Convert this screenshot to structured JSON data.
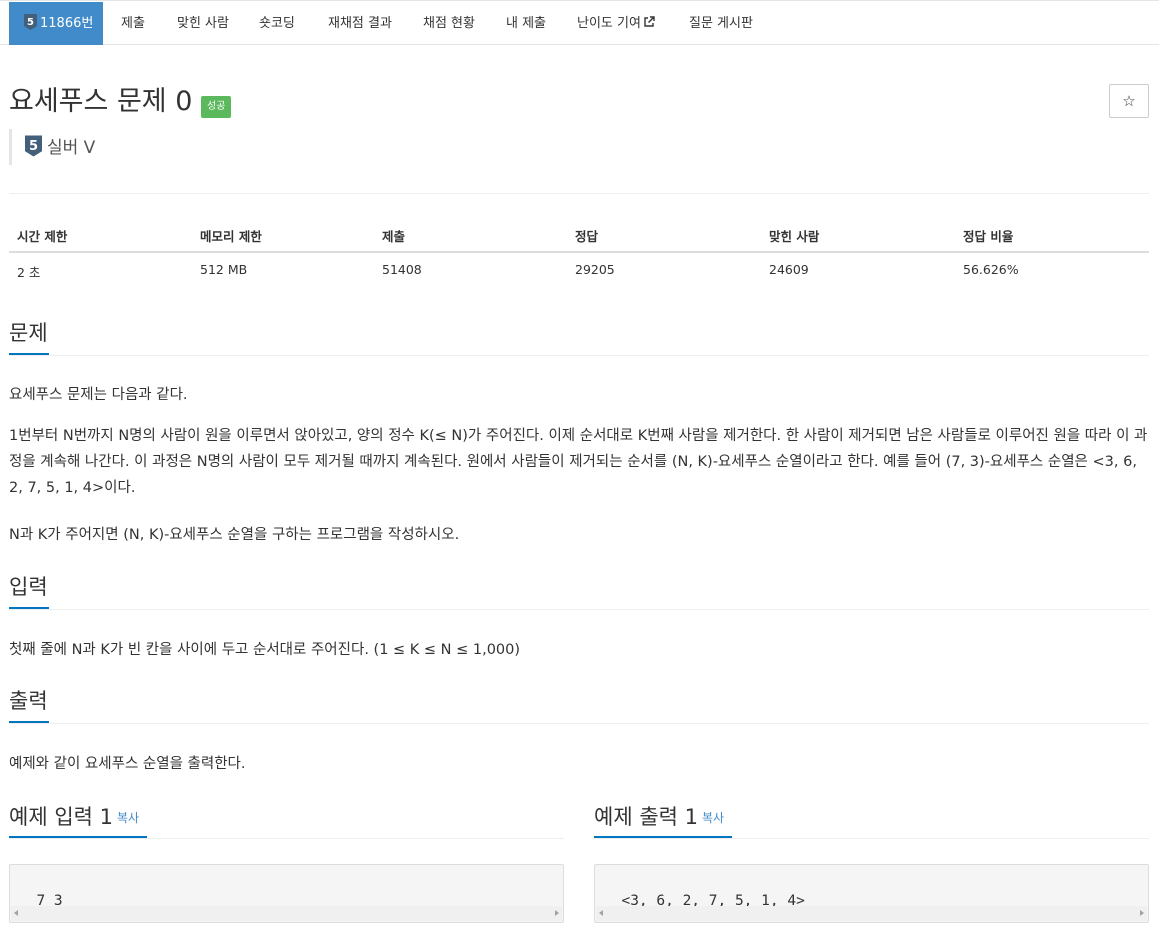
{
  "nav": {
    "problem_id": "11866번",
    "tier_digit": "5",
    "items": [
      {
        "label": "제출"
      },
      {
        "label": "맞힌 사람"
      },
      {
        "label": "숏코딩"
      },
      {
        "label": "재채점 결과"
      },
      {
        "label": "채점 현황"
      },
      {
        "label": "내 제출"
      },
      {
        "label": "난이도 기여"
      },
      {
        "label": "질문 게시판"
      }
    ]
  },
  "problem": {
    "title": "요세푸스 문제 0",
    "status_label": "성공",
    "star": "☆",
    "tier_digit": "5",
    "tier_name": "실버 V"
  },
  "stats": {
    "headers": [
      "시간 제한",
      "메모리 제한",
      "제출",
      "정답",
      "맞힌 사람",
      "정답 비율"
    ],
    "values": [
      "2 초",
      "512 MB",
      "51408",
      "29205",
      "24609",
      "56.626%"
    ]
  },
  "sections": {
    "description_title": "문제",
    "description_p1": "요세푸스 문제는 다음과 같다.",
    "description_p2": "1번부터 N번까지 N명의 사람이 원을 이루면서 앉아있고, 양의 정수 K(≤ N)가 주어진다. 이제 순서대로 K번째 사람을 제거한다. 한 사람이 제거되면 남은 사람들로 이루어진 원을 따라 이 과정을 계속해 나간다. 이 과정은 N명의 사람이 모두 제거될 때까지 계속된다. 원에서 사람들이 제거되는 순서를 (N, K)-요세푸스 순열이라고 한다. 예를 들어 (7, 3)-요세푸스 순열은 <3, 6, 2, 7, 5, 1, 4>이다.",
    "description_p3": "N과 K가 주어지면 (N, K)-요세푸스 순열을 구하는 프로그램을 작성하시오.",
    "input_title": "입력",
    "input_text": "첫째 줄에 N과 K가 빈 칸을 사이에 두고 순서대로 주어진다. (1 ≤ K ≤ N ≤ 1,000)",
    "output_title": "출력",
    "output_text": "예제와 같이 요세푸스 순열을 출력한다."
  },
  "examples": {
    "input_title": "예제 입력 1",
    "output_title": "예제 출력 1",
    "copy_label": "복사",
    "input_value": "7 3",
    "output_value": "<3, 6, 2, 7, 5, 1, 4>"
  },
  "colors": {
    "nav_active": "#428bca",
    "success": "#5cb85c",
    "section_underline": "#0076c0",
    "link": "#428bca"
  }
}
